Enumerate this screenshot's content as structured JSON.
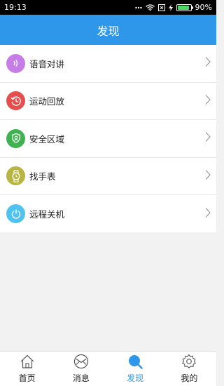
{
  "status_bar": {
    "time": "19:13",
    "battery_percent": "90%",
    "battery_level": 0.9,
    "icons": [
      "dots-icon",
      "wifi-icon",
      "sim-icon",
      "charging-icon",
      "battery-icon"
    ]
  },
  "header": {
    "title": "发现"
  },
  "menu": {
    "items": [
      {
        "label": "语音对讲",
        "icon": "voice-icon",
        "color": "#c67de6"
      },
      {
        "label": "运动回放",
        "icon": "replay-clock-icon",
        "color": "#e84d4d"
      },
      {
        "label": "安全区域",
        "icon": "shield-icon",
        "color": "#3fb34f"
      },
      {
        "label": "找手表",
        "icon": "watch-icon",
        "color": "#b8b541"
      },
      {
        "label": "远程关机",
        "icon": "power-icon",
        "color": "#4ec3ef"
      }
    ]
  },
  "bottom_nav": {
    "items": [
      {
        "label": "首页",
        "icon": "home-icon",
        "active": false
      },
      {
        "label": "消息",
        "icon": "message-icon",
        "active": false
      },
      {
        "label": "发现",
        "icon": "discover-icon",
        "active": true
      },
      {
        "label": "我的",
        "icon": "gear-icon",
        "active": false
      }
    ]
  },
  "colors": {
    "accent": "#2f97ea"
  }
}
